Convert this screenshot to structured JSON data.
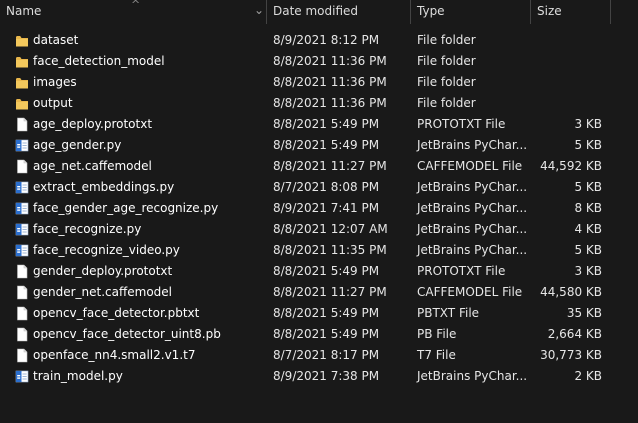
{
  "columns": {
    "name": "Name",
    "date": "Date modified",
    "type": "Type",
    "size": "Size"
  },
  "files": [
    {
      "name": "dataset",
      "date": "8/9/2021 8:12 PM",
      "type": "File folder",
      "size": "",
      "icon": "folder-icon"
    },
    {
      "name": "face_detection_model",
      "date": "8/8/2021 11:36 PM",
      "type": "File folder",
      "size": "",
      "icon": "folder-icon"
    },
    {
      "name": "images",
      "date": "8/8/2021 11:36 PM",
      "type": "File folder",
      "size": "",
      "icon": "folder-icon"
    },
    {
      "name": "output",
      "date": "8/8/2021 11:36 PM",
      "type": "File folder",
      "size": "",
      "icon": "folder-icon"
    },
    {
      "name": "age_deploy.prototxt",
      "date": "8/8/2021 5:49 PM",
      "type": "PROTOTXT File",
      "size": "3 KB",
      "icon": "file-icon"
    },
    {
      "name": "age_gender.py",
      "date": "8/8/2021 5:49 PM",
      "type": "JetBrains PyChar...",
      "size": "5 KB",
      "icon": "python-file-icon"
    },
    {
      "name": "age_net.caffemodel",
      "date": "8/8/2021 11:27 PM",
      "type": "CAFFEMODEL File",
      "size": "44,592 KB",
      "icon": "file-icon"
    },
    {
      "name": "extract_embeddings.py",
      "date": "8/7/2021 8:08 PM",
      "type": "JetBrains PyChar...",
      "size": "5 KB",
      "icon": "python-file-icon"
    },
    {
      "name": "face_gender_age_recognize.py",
      "date": "8/9/2021 7:41 PM",
      "type": "JetBrains PyChar...",
      "size": "8 KB",
      "icon": "python-file-icon"
    },
    {
      "name": "face_recognize.py",
      "date": "8/8/2021 12:07 AM",
      "type": "JetBrains PyChar...",
      "size": "4 KB",
      "icon": "python-file-icon"
    },
    {
      "name": "face_recognize_video.py",
      "date": "8/8/2021 11:35 PM",
      "type": "JetBrains PyChar...",
      "size": "5 KB",
      "icon": "python-file-icon"
    },
    {
      "name": "gender_deploy.prototxt",
      "date": "8/8/2021 5:49 PM",
      "type": "PROTOTXT File",
      "size": "3 KB",
      "icon": "file-icon"
    },
    {
      "name": "gender_net.caffemodel",
      "date": "8/8/2021 11:27 PM",
      "type": "CAFFEMODEL File",
      "size": "44,580 KB",
      "icon": "file-icon"
    },
    {
      "name": "opencv_face_detector.pbtxt",
      "date": "8/8/2021 5:49 PM",
      "type": "PBTXT File",
      "size": "35 KB",
      "icon": "file-icon"
    },
    {
      "name": "opencv_face_detector_uint8.pb",
      "date": "8/8/2021 5:49 PM",
      "type": "PB File",
      "size": "2,664 KB",
      "icon": "file-icon"
    },
    {
      "name": "openface_nn4.small2.v1.t7",
      "date": "8/7/2021 8:17 PM",
      "type": "T7 File",
      "size": "30,773 KB",
      "icon": "file-icon"
    },
    {
      "name": "train_model.py",
      "date": "8/9/2021 7:38 PM",
      "type": "JetBrains PyChar...",
      "size": "2 KB",
      "icon": "python-file-icon"
    }
  ],
  "colors": {
    "background": "#191919",
    "folder": "#e8b64b",
    "python_accent": "#2b6fcf"
  }
}
